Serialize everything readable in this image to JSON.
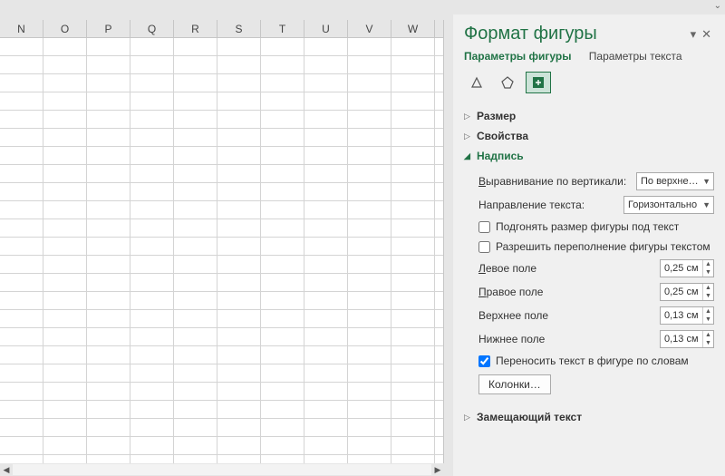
{
  "columns": [
    "N",
    "O",
    "P",
    "Q",
    "R",
    "S",
    "T",
    "U",
    "V",
    "W"
  ],
  "panel": {
    "title": "Формат фигуры",
    "tabs": {
      "active": "Параметры фигуры",
      "other": "Параметры текста"
    },
    "sections": {
      "size": "Размер",
      "props": "Свойства",
      "textbox": "Надпись",
      "alttext": "Замещающий текст"
    },
    "textbox": {
      "valign_label": "Выравнивание по вертикали:",
      "valign_value": "По верхне…",
      "dir_label": "Направление текста:",
      "dir_value": "Горизонтально",
      "autofit": "Подгонять размер фигуры под текст",
      "overflow": "Разрешить переполнение фигуры текстом",
      "left_label": "Левое поле",
      "left_value": "0,25 см",
      "right_label": "Правое поле",
      "right_value": "0,25 см",
      "top_label": "Верхнее поле",
      "top_value": "0,13 см",
      "bottom_label": "Нижнее поле",
      "bottom_value": "0,13 см",
      "wrap": "Переносить текст в фигуре по словам",
      "columns_btn": "Колонки…"
    }
  }
}
